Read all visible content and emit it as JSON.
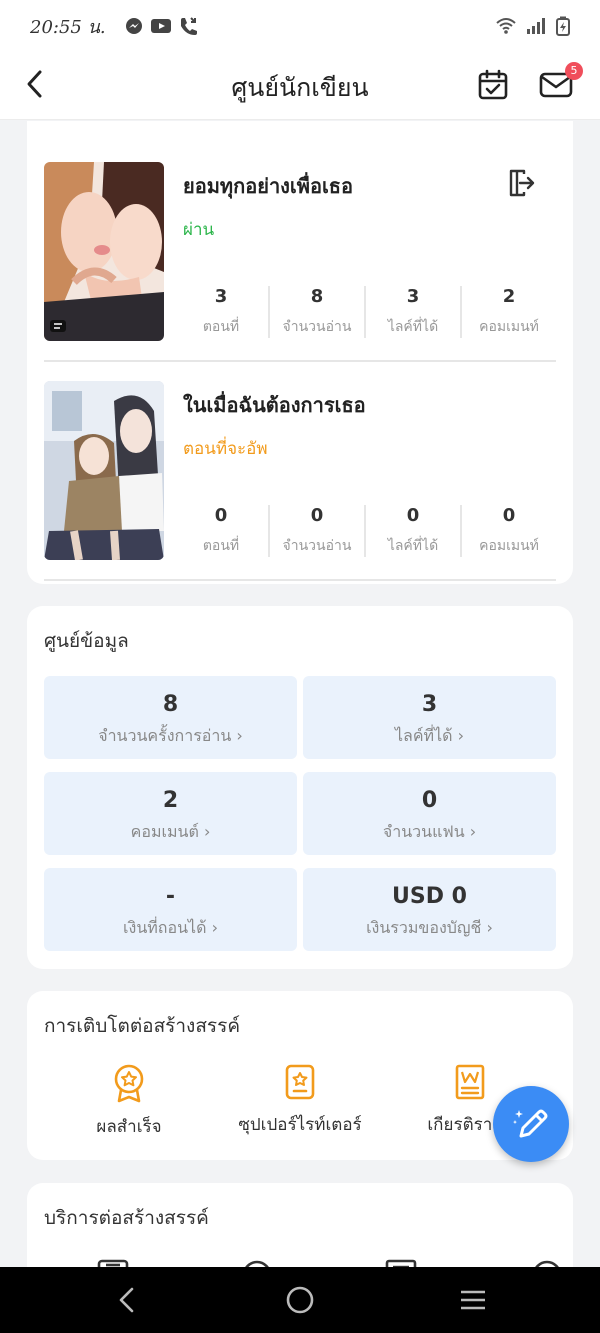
{
  "status_bar": {
    "time": "20:55 น.",
    "notification_icons": [
      "messenger-icon",
      "youtube-icon",
      "missed-call-icon"
    ],
    "system_icons": [
      "wifi-icon",
      "signal-icon",
      "battery-charging-icon"
    ]
  },
  "header": {
    "title": "ศูนย์นักเขียน",
    "mail_badge": "5"
  },
  "works": [
    {
      "title": "ยอมทุกอย่างเพื่อเธอ",
      "status": "ผ่าน",
      "status_color": "#2bb54a",
      "stats": [
        {
          "value": "3",
          "label": "ตอนที่"
        },
        {
          "value": "8",
          "label": "จำนวนอ่าน"
        },
        {
          "value": "3",
          "label": "ไลค์ที่ได้"
        },
        {
          "value": "2",
          "label": "คอมเมนท์"
        }
      ]
    },
    {
      "title": "ในเมื่อฉันต้องการเธอ",
      "status": "ตอนที่จะอัพ",
      "status_color": "#f29b1c",
      "stats": [
        {
          "value": "0",
          "label": "ตอนที่"
        },
        {
          "value": "0",
          "label": "จำนวนอ่าน"
        },
        {
          "value": "0",
          "label": "ไลค์ที่ได้"
        },
        {
          "value": "0",
          "label": "คอมเมนท์"
        }
      ]
    }
  ],
  "data_center": {
    "title": "ศูนย์ข้อมูล",
    "items": [
      {
        "value": "8",
        "label": "จำนวนครั้งการอ่าน"
      },
      {
        "value": "3",
        "label": "ไลค์ที่ได้"
      },
      {
        "value": "2",
        "label": "คอมเมนต์"
      },
      {
        "value": "0",
        "label": "จำนวนแฟน"
      },
      {
        "value": "-",
        "label": "เงินที่ถอนได้"
      },
      {
        "value": "USD 0",
        "label": "เงินรวมของบัญชี"
      }
    ],
    "chevron": "›"
  },
  "growth": {
    "title": "การเติบโตต่อสร้างสรรค์",
    "items": [
      {
        "label": "ผลสำเร็จ",
        "icon": "achievement-medal-icon"
      },
      {
        "label": "ซุปเปอร์ไรท์เตอร์",
        "icon": "super-writer-badge-icon"
      },
      {
        "label": "เกียรติรายส",
        "icon": "honor-certificate-icon"
      }
    ]
  },
  "services": {
    "title": "บริการต่อสร้างสรรค์"
  },
  "colors": {
    "accent_orange": "#f29b1c",
    "fab_blue": "#3b8cf5",
    "info_box_bg": "#eaf2fc"
  }
}
